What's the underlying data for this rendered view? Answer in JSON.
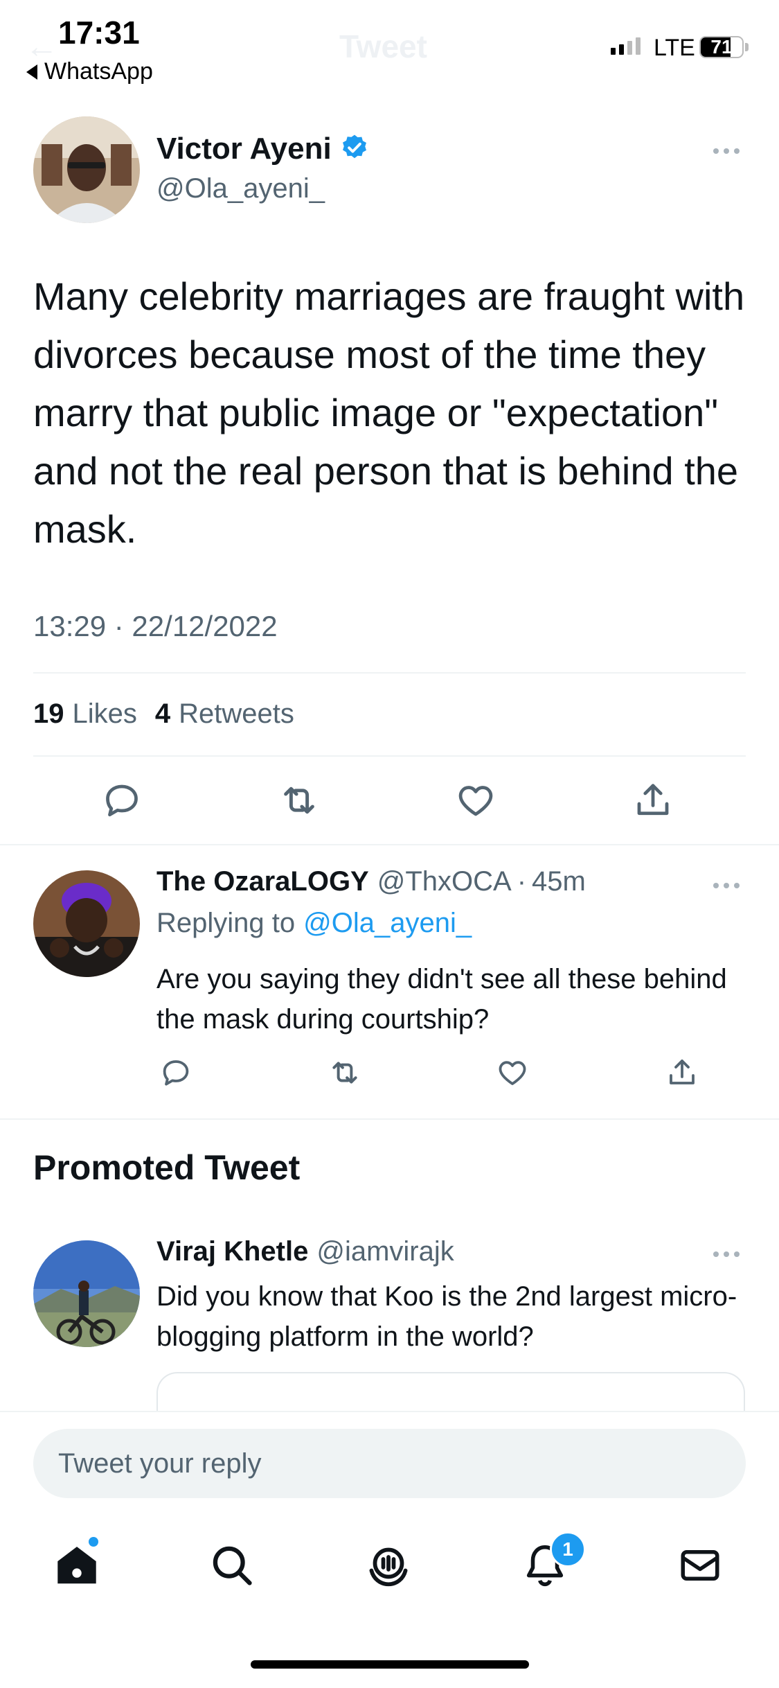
{
  "status_bar": {
    "time": "17:31",
    "back_app": "WhatsApp",
    "network": "LTE",
    "battery": "71",
    "battery_level": 0.71
  },
  "header": {
    "title": "Tweet"
  },
  "tweet": {
    "author_name": "Victor Ayeni",
    "author_handle": "@Ola_ayeni_",
    "verified": true,
    "text": "Many celebrity marriages are fraught with divorces because most of the time they marry that public image or \"expectation\" and not the real person that is behind the mask.",
    "timestamp": "13:29 · 22/12/2022",
    "likes_count": "19",
    "likes_label": "Likes",
    "retweets_count": "4",
    "retweets_label": "Retweets"
  },
  "reply": {
    "author_name": "The OzaraLOGY",
    "author_handle": "@ThxOCA",
    "separator": "·",
    "time_ago": "45m",
    "replying_prefix": "Replying to",
    "replying_to": "@Ola_ayeni_",
    "text": "Are you saying they didn't see all these behind the mask during courtship?"
  },
  "promoted": {
    "heading": "Promoted Tweet",
    "author_name": "Viraj Khetle",
    "author_handle": "@iamvirajk",
    "text": "Did you know that Koo is the 2nd largest micro-blogging platform in the world?"
  },
  "composer": {
    "placeholder": "Tweet your reply"
  },
  "tab_bar": {
    "notifications_badge": "1"
  },
  "colors": {
    "accent": "#1d9bf0",
    "secondary_text": "#536471",
    "divider": "#eff3f4"
  }
}
